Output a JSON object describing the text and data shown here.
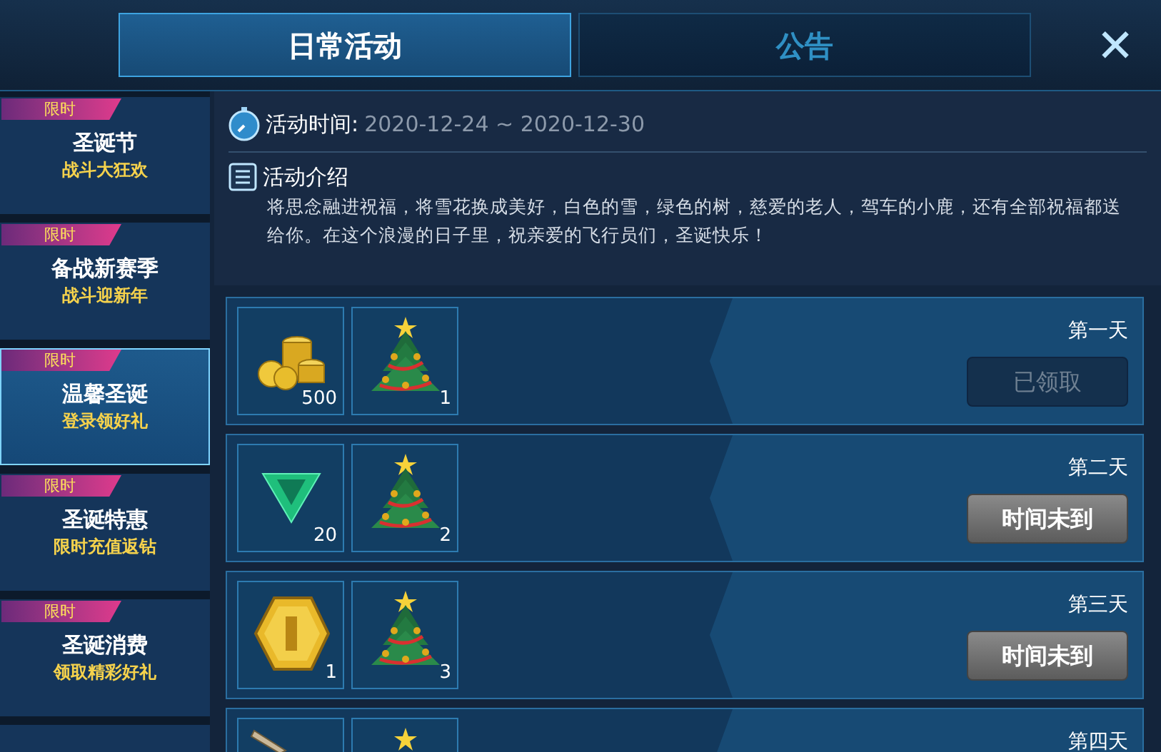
{
  "tabs": [
    {
      "label": "日常活动",
      "selected": true
    },
    {
      "label": "公告",
      "selected": false
    }
  ],
  "close": "✕",
  "sidebar": {
    "items": [
      {
        "badge": "限时",
        "title": "圣诞节",
        "subtitle": "战斗大狂欢",
        "selected": false
      },
      {
        "badge": "限时",
        "title": "备战新赛季",
        "subtitle": "战斗迎新年",
        "selected": false
      },
      {
        "badge": "限时",
        "title": "温馨圣诞",
        "subtitle": "登录领好礼",
        "selected": true
      },
      {
        "badge": "限时",
        "title": "圣诞特惠",
        "subtitle": "限时充值返钻",
        "selected": false
      },
      {
        "badge": "限时",
        "title": "圣诞消费",
        "subtitle": "领取精彩好礼",
        "selected": false
      }
    ]
  },
  "info": {
    "time_label": "活动时间:",
    "time_value": "2020-12-24 ~ 2020-12-30",
    "intro_title": "活动介绍",
    "intro_text": "将思念融进祝福，将雪花换成美好，白色的雪，绿色的树，慈爱的老人，驾车的小鹿，还有全部祝福都送给你。在这个浪漫的日子里，祝亲爱的飞行员们，圣诞快乐！"
  },
  "rewards": [
    {
      "day": "第一天",
      "button": {
        "label": "已领取",
        "claimed": true
      },
      "items": [
        {
          "kind": "coins",
          "count": "500"
        },
        {
          "kind": "tree",
          "count": "1"
        }
      ]
    },
    {
      "day": "第二天",
      "button": {
        "label": "时间未到",
        "claimed": false
      },
      "items": [
        {
          "kind": "gem",
          "count": "20"
        },
        {
          "kind": "tree",
          "count": "2"
        }
      ]
    },
    {
      "day": "第三天",
      "button": {
        "label": "时间未到",
        "claimed": false
      },
      "items": [
        {
          "kind": "medal",
          "count": "1"
        },
        {
          "kind": "tree",
          "count": "3"
        }
      ]
    },
    {
      "day": "第四天",
      "items": [
        {
          "kind": "sword"
        },
        {
          "kind": "tree_top"
        }
      ]
    }
  ]
}
